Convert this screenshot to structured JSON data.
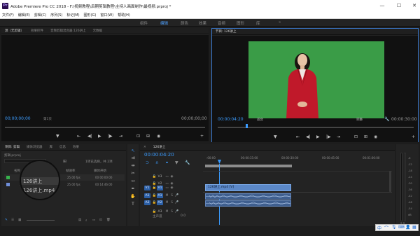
{
  "titlebar": {
    "app_icon": "Pr",
    "title": "Adobe Premiere Pro CC 2018 - F:\\视频教程\\后期剪辑教程\\主持人画面制作\\最视频.prproj *",
    "min": "—",
    "max": "☐",
    "close": "✕"
  },
  "menu": [
    "文件(F)",
    "编辑(E)",
    "剪辑(C)",
    "序列(S)",
    "标记(M)",
    "图形(G)",
    "窗口(W)",
    "帮助(H)"
  ],
  "workspaces": [
    "组件",
    "编辑",
    "颜色",
    "效果",
    "音频",
    "图形",
    "库"
  ],
  "workspace_more": "»",
  "source": {
    "tabs": [
      "源（无剪辑）",
      "效果控件",
      "音频剪辑混合器:126讲上",
      "元数据"
    ],
    "tc_left": "00;00;00;00",
    "page": "第1页",
    "tc_right": "00;00;00;00"
  },
  "program": {
    "tab": "节目: 126讲上",
    "tc_left": "00:00:04:20",
    "fit": "适合",
    "quality": "完整",
    "tc_right": "00:00:30:00"
  },
  "project": {
    "tabs": [
      "项目: 剪辑",
      "媒体浏览器",
      "库",
      "信息",
      "效果"
    ],
    "name": "剪辑.prproj",
    "selection": "1项已选择，共 2项",
    "columns": {
      "name": "名称",
      "rate": "帧速率",
      "start": "媒体开始"
    },
    "items": [
      {
        "name": "126讲上",
        "rate": "25.00 fps",
        "start": "00:00:00:00",
        "color": "#37b24d"
      },
      {
        "name": "126讲上.mp4",
        "rate": "25.00 fps",
        "start": "00:14:46:00",
        "color": "#6f8ed8"
      }
    ]
  },
  "timeline": {
    "tab": "126讲上",
    "tc": "00:00:04:20",
    "ruler": [
      ":00:00",
      "00:00:15:00",
      "00:00:30:00",
      "00:00:45:00",
      "00:01:00:00"
    ],
    "tracks": [
      {
        "target": "",
        "label": "V3"
      },
      {
        "target": "",
        "label": "V2"
      },
      {
        "target": "V1",
        "label": "V1"
      },
      {
        "target": "A1",
        "label": "A1"
      },
      {
        "target": "A2",
        "label": "A2"
      },
      {
        "target": "",
        "label": "A3"
      },
      {
        "target": "",
        "label": "主声道"
      }
    ],
    "clip_label": "126讲上.mp4 [V]",
    "master_val": "0.0"
  },
  "meters": {
    "labels": [
      "-6",
      "-12",
      "-18",
      "-24",
      "-30",
      "-36",
      "-42",
      "-48",
      "-54",
      "dB"
    ],
    "solo": "S S"
  },
  "colors": {
    "accent": "#3b9cff",
    "green_screen": "#3a9c47",
    "blazer": "#c0192a"
  },
  "magnifier": {
    "item1": "126讲上",
    "item2": "126讲上.mp4"
  }
}
